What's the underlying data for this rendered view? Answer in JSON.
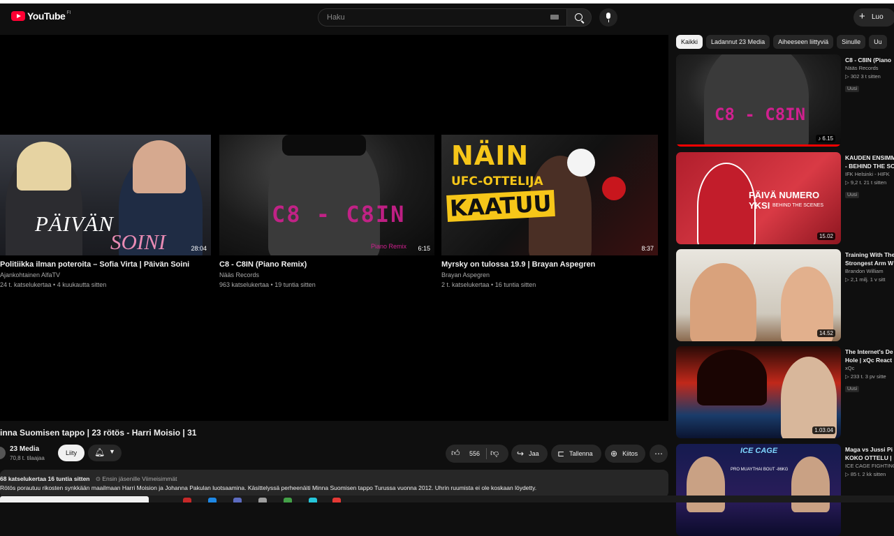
{
  "masthead": {
    "logo_text": "YouTube",
    "country_code": "FI",
    "search_placeholder": "Haku",
    "create_label": "Luo"
  },
  "end_screen": [
    {
      "title": "Politiikka ilman poteroita – Sofia Virta | Päivän Soini",
      "channel": "Ajankohtainen AlfaTV",
      "meta": "24 t. katselukertaa • 4 kuukautta sitten",
      "duration": "28:04",
      "thumb_text_1": "PÄIVÄN",
      "thumb_text_2": "SOINI"
    },
    {
      "title": "C8 - C8IN (Piano Remix)",
      "channel": "Nääs Records",
      "meta": "963 katselukertaa • 19 tuntia sitten",
      "duration": "6:15",
      "thumb_text_1": "C8 - C8IN",
      "thumb_text_2": "Piano Remix"
    },
    {
      "title": "Myrsky on tulossa 19.9 | Brayan Aspegren",
      "channel": "Brayan Aspegren",
      "meta": "2 t. katselukertaa • 16 tuntia sitten",
      "duration": "8:37",
      "thumb_text_1": "NÄIN",
      "thumb_text_2": "UFC-OTTELIJA",
      "thumb_text_3": "KAATUU"
    }
  ],
  "video": {
    "title": "inna Suomisen tappo | 23 rötös - Harri Moisio | 31",
    "channel": "23 Media",
    "subscribers": "70,8 t. tilaajaa",
    "join_label": "Liity",
    "likes": "556",
    "share_label": "Jaa",
    "save_label": "Tallenna",
    "thanks_label": "Kiitos",
    "views_time": "68 katselukertaa  16 tuntia sitten",
    "tags": "⊙ Ensin jäsenille  Viimeisimmät",
    "description": "Rötös porautuu rikosten synkkään maailmaan Harri Moision ja Johanna Pakulan luotsaamina. Käsittelyssä perheenäiti Minna Suomisen tappo Turussa vuonna 2012. Uhrin ruumista ei ole koskaan löydetty."
  },
  "chips": [
    "Kaikki",
    "Ladannut 23 Media",
    "Aiheeseen liittyviä",
    "Sinulle",
    "Uu"
  ],
  "recommendations": [
    {
      "title": "C8 - C8IN (Piano",
      "channel": "Nääs Records",
      "meta": "▷ 302  3 t sitten",
      "badge": "Uusi",
      "duration": "♪ 6.15",
      "thumb_text": "C8 - C8IN",
      "watched": 1.0
    },
    {
      "title": "KAUDEN ENSIMM",
      "title2": "- BEHIND THE SC",
      "channel": "IFK Helsinki - HIFK",
      "meta": "▷ 9,2 t.  21 t sitten",
      "badge": "Uusi",
      "duration": "15.02",
      "thumb_text": "PÄIVÄ NUMERO YKSI",
      "thumb_sub": "BEHIND THE SCENES"
    },
    {
      "title": "Training With The",
      "title2": "Strongest Arm W",
      "channel": "Brandon William",
      "meta": "▷ 2,1 milj.  1 v sitt",
      "duration": "14.52"
    },
    {
      "title": "The Internet's De",
      "title2": "Hole | xQc React",
      "channel": "xQc",
      "meta": "▷ 233 t.  3 pv sitte",
      "badge": "Uusi",
      "duration": "1.03.04"
    },
    {
      "title": "Maga vs Jussi Pi",
      "title2": "KOKO OTTELU |",
      "channel": "ICE CAGE FIGHTING",
      "meta": "▷ 85 t.  2 kk sitten",
      "thumb_text": "ICE CAGE",
      "thumb_sub": "PRO MUAYTHAI BOUT -86KG"
    }
  ]
}
